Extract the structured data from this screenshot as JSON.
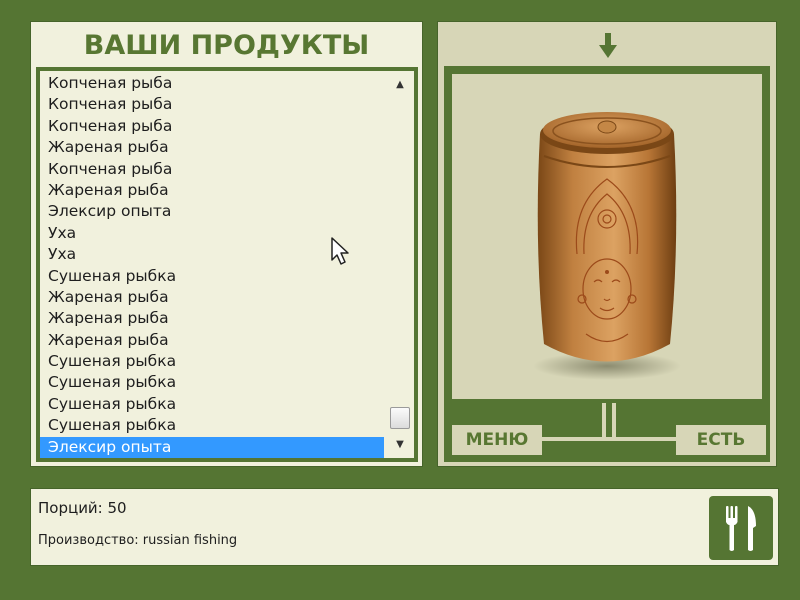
{
  "left_panel": {
    "title": "ВАШИ ПРОДУКТЫ",
    "items": [
      {
        "label": "Копченая рыба"
      },
      {
        "label": "Копченая рыба"
      },
      {
        "label": "Копченая рыба"
      },
      {
        "label": "Жареная рыба"
      },
      {
        "label": "Копченая рыба"
      },
      {
        "label": "Жареная рыба"
      },
      {
        "label": "Элексир опыта"
      },
      {
        "label": "Уха"
      },
      {
        "label": "Уха"
      },
      {
        "label": "Сушеная рыбка"
      },
      {
        "label": "Жареная рыба"
      },
      {
        "label": "Жареная рыба"
      },
      {
        "label": "Жареная рыба"
      },
      {
        "label": "Сушеная рыбка"
      },
      {
        "label": "Сушеная рыбка"
      },
      {
        "label": "Сушеная рыбка"
      },
      {
        "label": "Сушеная рыбка"
      },
      {
        "label": "Элексир опыта",
        "selected": true
      }
    ],
    "selected_index": 17
  },
  "right_panel": {
    "arrow_icon": "down-arrow-icon",
    "image": "carved-barrel-with-goddess-face",
    "menu_label": "МЕНЮ",
    "eat_label": "ЕСТЬ"
  },
  "bottom_panel": {
    "portions": "Порций: 50",
    "production": "Производство: russian fishing",
    "utensils_icon": "fork-knife-icon"
  },
  "colors": {
    "background": "#557533",
    "panel_light": "#f1f1dd",
    "panel_beige": "#d7d6b7",
    "title_green": "#587732",
    "selection": "#3399ff"
  }
}
